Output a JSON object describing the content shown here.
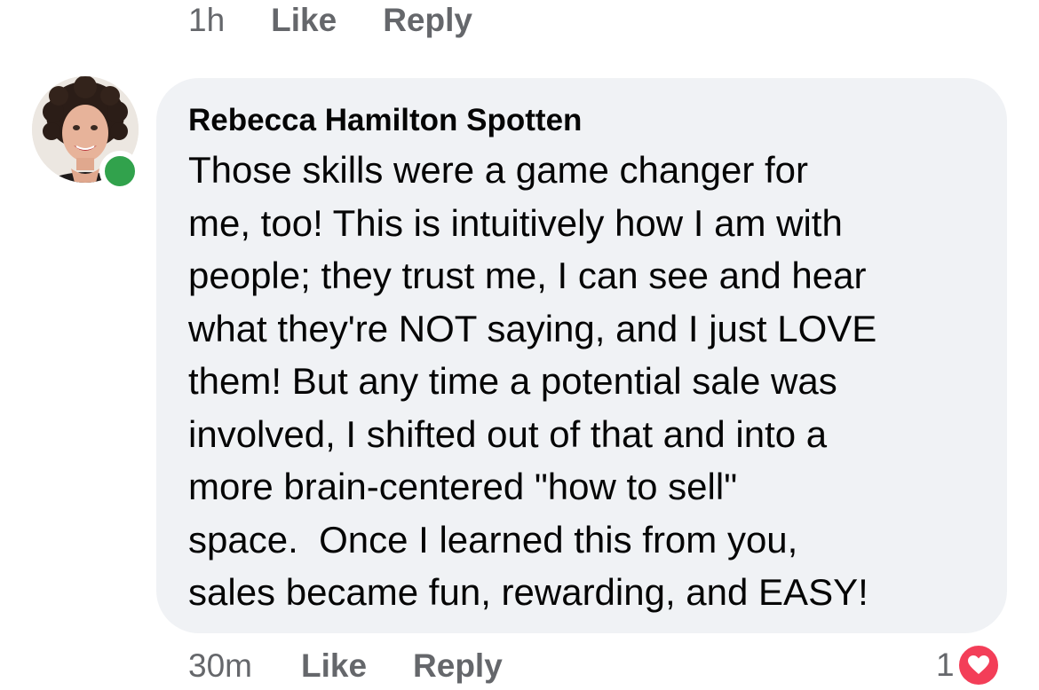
{
  "previous_comment": {
    "time": "1h",
    "like_label": "Like",
    "reply_label": "Reply"
  },
  "comment": {
    "author": "Rebecca Hamilton Spotten",
    "lines": [
      "Those skills were a game changer for",
      "me, too! This is intuitively how I am with",
      "people; they trust me, I can see and hear",
      "what they're NOT saying, and I just LOVE",
      "them! But any time a potential sale was",
      "involved, I shifted out of that and into a",
      "more brain-centered \"how to sell\"",
      "space.  Once I learned this from you,",
      "sales became fun, rewarding, and EASY!"
    ],
    "time": "30m",
    "like_label": "Like",
    "reply_label": "Reply",
    "reaction_count": "1",
    "reaction_icon": "heart-icon",
    "author_online": true
  },
  "colors": {
    "bubble": "#f0f2f5",
    "meta_text": "#65676b",
    "online": "#31a24c",
    "love": "#f33e58"
  }
}
